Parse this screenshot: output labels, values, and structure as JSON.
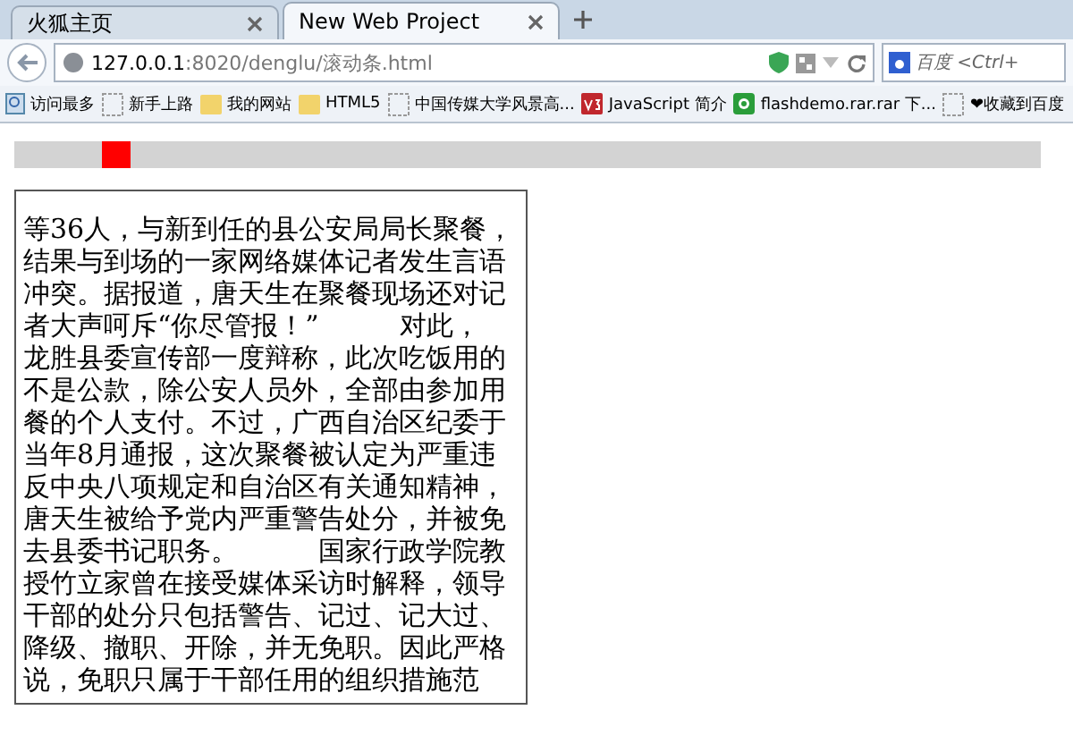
{
  "tabs": [
    {
      "label": "火狐主页",
      "selected": false
    },
    {
      "label": "New Web Project",
      "selected": true
    }
  ],
  "address_bar": {
    "host": "127.0.0.1",
    "path": ":8020/denglu/滚动条.html"
  },
  "search": {
    "placeholder": "百度 <Ctrl+"
  },
  "bookmarks": [
    {
      "label": "访问最多",
      "kind": "smart"
    },
    {
      "label": "新手上路",
      "kind": "page"
    },
    {
      "label": "我的网站",
      "kind": "folder"
    },
    {
      "label": "HTML5",
      "kind": "folder"
    },
    {
      "label": "中国传媒大学风景高...",
      "kind": "page"
    },
    {
      "label": "JavaScript 简介",
      "kind": "v3"
    },
    {
      "label": "flashdemo.rar.rar 下...",
      "kind": "green"
    },
    {
      "label": "❤收藏到百度",
      "kind": "page"
    }
  ],
  "article": {
    "lines": [
      "等36人，与新到任的县公安局局长聚餐，",
      "结果与到场的一家网络媒体记者发生言语",
      "冲突。据报道，唐天生在聚餐现场还对记",
      "者大声呵斥“你尽管报！”　　　对此，",
      "龙胜县委宣传部一度辩称，此次吃饭用的",
      "不是公款，除公安人员外，全部由参加用",
      "餐的个人支付。不过，广西自治区纪委于",
      "当年8月通报，这次聚餐被认定为严重违",
      "反中央八项规定和自治区有关通知精神，",
      "唐天生被给予党内严重警告处分，并被免",
      "去县委书记职务。　　　国家行政学院教",
      "授竹立家曾在接受媒体采访时解释，领导",
      "干部的处分只包括警告、记过、记大过、",
      "降级、撤职、开除，并无免职。因此严格",
      "说，免职只属于干部任用的组织措施范"
    ]
  }
}
